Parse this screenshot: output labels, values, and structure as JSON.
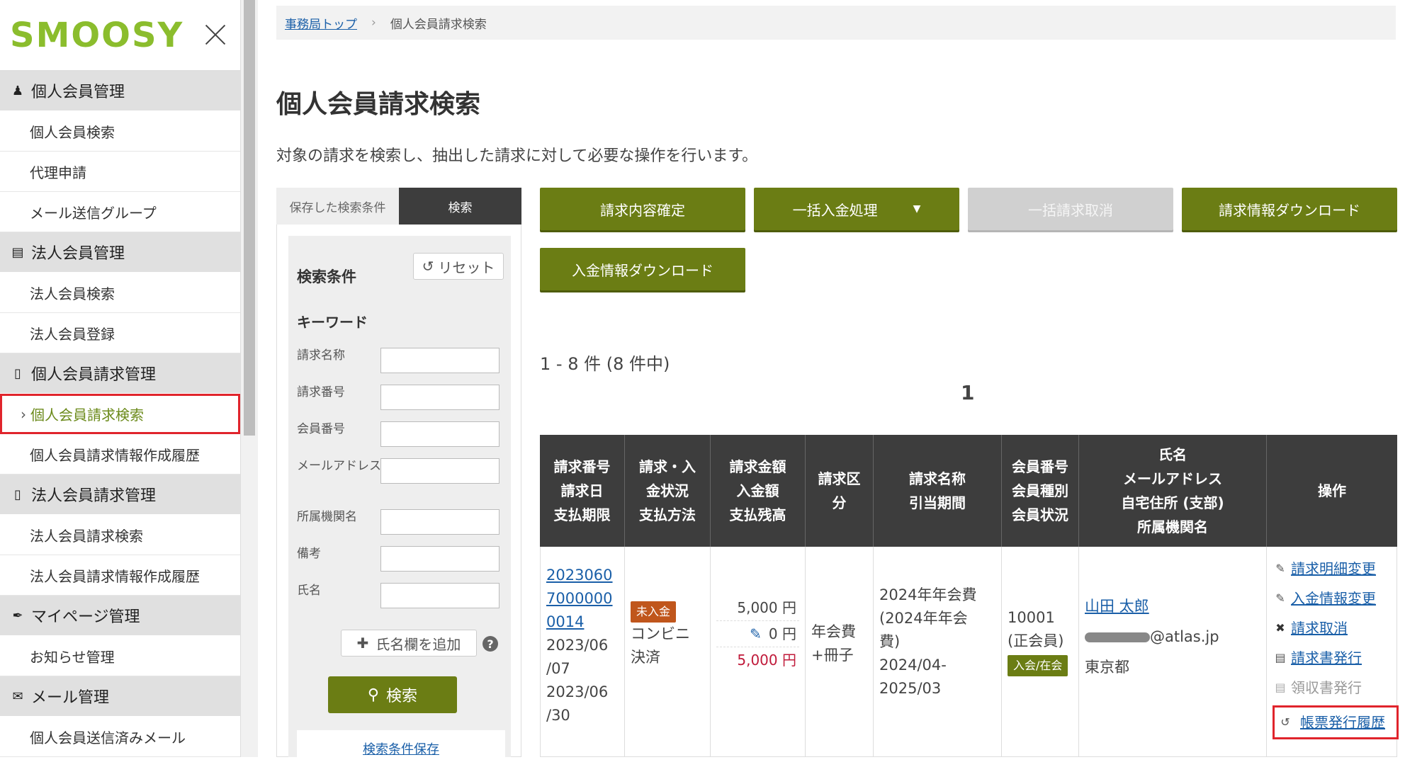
{
  "sidebar": {
    "logo_text": "SMOOSY",
    "groups": [
      {
        "label": "個人会員管理",
        "icon": "person-icon",
        "items": [
          "個人会員検索",
          "代理申請",
          "メール送信グループ"
        ]
      },
      {
        "label": "法人会員管理",
        "icon": "building-icon",
        "items": [
          "法人会員検索",
          "法人会員登録"
        ]
      },
      {
        "label": "個人会員請求管理",
        "icon": "document-icon",
        "items": [
          "個人会員請求検索",
          "個人会員請求情報作成履歴"
        ]
      },
      {
        "label": "法人会員請求管理",
        "icon": "document-icon",
        "items": [
          "法人会員請求検索",
          "法人会員請求情報作成履歴"
        ]
      },
      {
        "label": "マイページ管理",
        "icon": "pen-icon",
        "items": [
          "お知らせ管理"
        ]
      },
      {
        "label": "メール管理",
        "icon": "mail-icon",
        "items": [
          "個人会員送信済みメール"
        ]
      }
    ],
    "active_item": "個人会員請求検索",
    "active_chevron": "›"
  },
  "breadcrumb": {
    "home": "事務局トップ",
    "sep": "›",
    "current": "個人会員請求検索"
  },
  "page": {
    "title": "個人会員請求検索",
    "description": "対象の請求を検索し、抽出した請求に対して必要な操作を行います。"
  },
  "search": {
    "tab_saved": "保存した検索条件",
    "tab_search": "検索",
    "cond_title": "検索条件",
    "reset_label": "リセット",
    "keyword_title": "キーワード",
    "fields": [
      "請求名称",
      "請求番号",
      "会員番号",
      "メールアドレス",
      "所属機関名",
      "備考",
      "氏名"
    ],
    "add_name_label": "氏名欄を追加",
    "help": "?",
    "search_label": "検索",
    "save_label": "検索条件保存"
  },
  "actions": {
    "confirm": "請求内容確定",
    "bulk_payment": "一括入金処理",
    "bulk_cancel": "一括請求取消",
    "download_billing": "請求情報ダウンロード",
    "download_payment": "入金情報ダウンロード"
  },
  "results": {
    "count_text": "1 - 8 件 (8 件中)",
    "page": "1"
  },
  "table": {
    "headers": [
      "請求番号\n請求日\n支払期限",
      "請求・入\n金状況\n支払方法",
      "請求金額\n入金額\n支払残高",
      "請求区\n分",
      "請求名称\n引当期間",
      "会員番号\n会員種別\n会員状況",
      "氏名\nメールアドレス\n自宅住所 (支部)\n所属機関名",
      "操作"
    ],
    "rows": [
      {
        "invoice_no": "20230607000000014",
        "invoice_no_l1": "2023060",
        "invoice_no_l2": "7000000",
        "invoice_no_l3": "0014",
        "invoice_date_l1": "2023/06",
        "invoice_date_l2": "/07",
        "due_date_l1": "2023/06",
        "due_date_l2": "/30",
        "status_badge": "未入金",
        "payment_l1": "コンビニ",
        "payment_l2": "決済",
        "amount_billed": "5,000 円",
        "amount_paid": "0 円",
        "amount_remaining": "5,000 円",
        "category_l1": "年会費",
        "category_l2": "+冊子",
        "name_l1": "2024年年会費",
        "name_l2": "(2024年年会",
        "name_l3": "費)",
        "period_l1": "2024/04-",
        "period_l2": "2025/03",
        "member_no": "10001",
        "member_type": "(正会員)",
        "member_status": "入会/在会",
        "member_name": "山田 太郎",
        "email": "@atlas.jp",
        "address": "東京都",
        "ops": [
          "請求明細変更",
          "入金情報変更",
          "請求取消",
          "請求書発行",
          "領収書発行",
          "帳票発行履歴"
        ]
      }
    ]
  },
  "colors": {
    "olive": "#6b7d14",
    "highlight_red": "#e0242c",
    "header_dark": "#3d3d3d",
    "badge_orange": "#c0561c"
  }
}
